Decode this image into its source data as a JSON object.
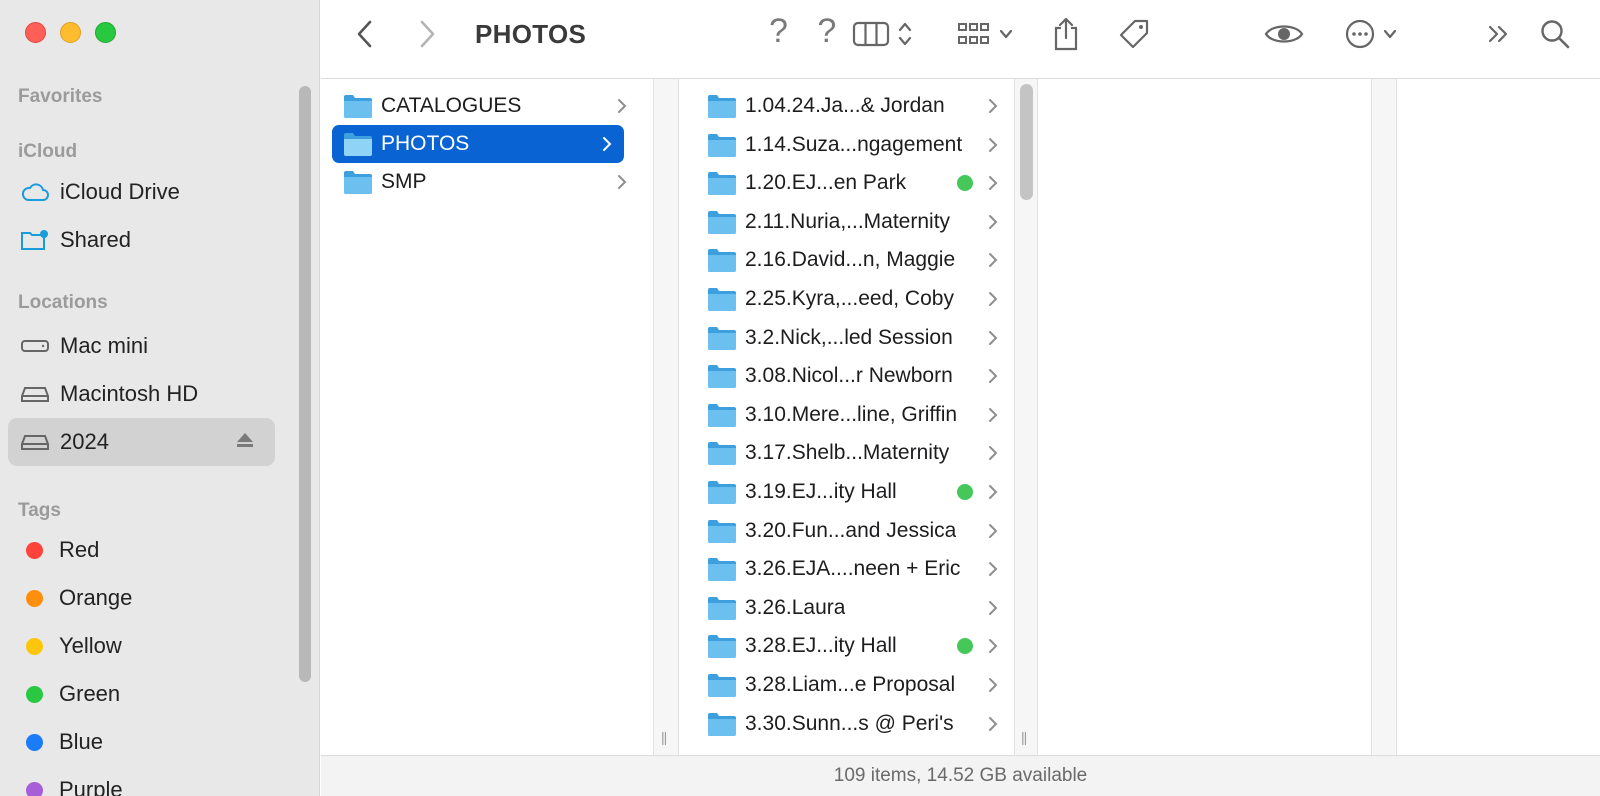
{
  "window": {
    "title": "PHOTOS",
    "status": "109 items, 14.52 GB available"
  },
  "toolbar": {
    "help_marks": "? ?"
  },
  "sidebar": {
    "favorites_label": "Favorites",
    "icloud_label": "iCloud",
    "icloud_items": [
      {
        "label": "iCloud Drive",
        "icon": "cloud-icon"
      },
      {
        "label": "Shared",
        "icon": "shared-folder-icon"
      }
    ],
    "locations_label": "Locations",
    "location_items": [
      {
        "label": "Mac mini",
        "icon": "mac-mini-icon"
      },
      {
        "label": "Macintosh HD",
        "icon": "drive-icon"
      },
      {
        "label": "2024",
        "icon": "drive-icon",
        "selected": true
      }
    ],
    "tags_label": "Tags",
    "tags": [
      {
        "label": "Red",
        "color": "#fe443a"
      },
      {
        "label": "Orange",
        "color": "#fe8f0b"
      },
      {
        "label": "Yellow",
        "color": "#fec60b"
      },
      {
        "label": "Green",
        "color": "#28c840"
      },
      {
        "label": "Blue",
        "color": "#1a7cf9"
      },
      {
        "label": "Purple",
        "color": "#a65fd8"
      }
    ]
  },
  "column1": [
    {
      "label": "CATALOGUES"
    },
    {
      "label": "PHOTOS",
      "selected": true
    },
    {
      "label": "SMP"
    }
  ],
  "column2": [
    {
      "label": "1.04.24.Ja...& Jordan"
    },
    {
      "label": "1.14.Suza...ngagement"
    },
    {
      "label": "1.20.EJ...en Park",
      "tag": "green"
    },
    {
      "label": "2.11.Nuria,...Maternity"
    },
    {
      "label": "2.16.David...n, Maggie"
    },
    {
      "label": "2.25.Kyra,...eed, Coby"
    },
    {
      "label": "3.2.Nick,...led Session"
    },
    {
      "label": "3.08.Nicol...r Newborn"
    },
    {
      "label": "3.10.Mere...line, Griffin"
    },
    {
      "label": "3.17.Shelb...Maternity"
    },
    {
      "label": "3.19.EJ...ity Hall",
      "tag": "green"
    },
    {
      "label": "3.20.Fun...and Jessica"
    },
    {
      "label": "3.26.EJA....neen + Eric"
    },
    {
      "label": "3.26.Laura"
    },
    {
      "label": "3.28.EJ...ity Hall",
      "tag": "green"
    },
    {
      "label": "3.28.Liam...e Proposal"
    },
    {
      "label": "3.30.Sunn...s @ Peri's"
    }
  ]
}
